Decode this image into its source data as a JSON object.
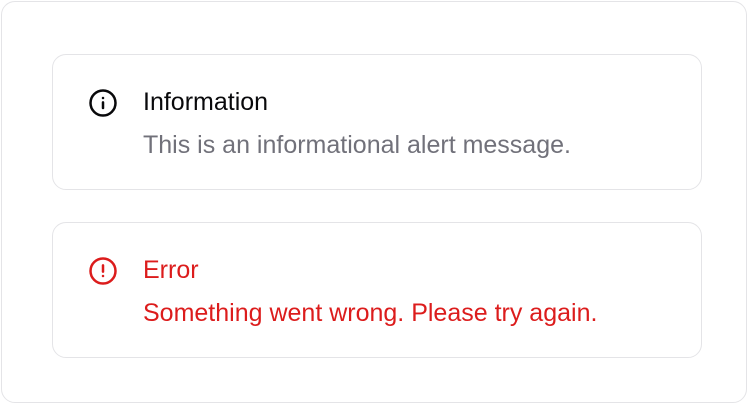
{
  "colors": {
    "border": "#e4e4e7",
    "foreground": "#09090b",
    "muted": "#71717a",
    "destructive": "#dc1c1c"
  },
  "alerts": [
    {
      "variant": "default",
      "icon": "info-circle-icon",
      "title": "Information",
      "description": "This is an informational alert message."
    },
    {
      "variant": "destructive",
      "icon": "alert-circle-icon",
      "title": "Error",
      "description": "Something went wrong. Please try again."
    }
  ]
}
